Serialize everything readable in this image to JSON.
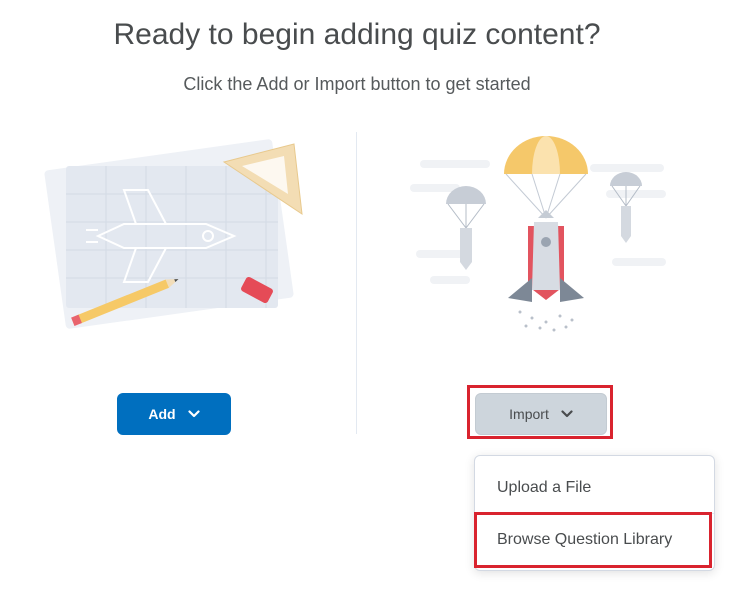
{
  "page": {
    "heading": "Ready to begin adding quiz content?",
    "subheading": "Click the Add or Import button to get started"
  },
  "actions": {
    "add_label": "Add",
    "import_label": "Import"
  },
  "import_menu": {
    "items": [
      {
        "label": "Upload a File"
      },
      {
        "label": "Browse Question Library"
      }
    ]
  },
  "icons": {
    "add_chevron": "chevron-down-icon",
    "import_chevron": "chevron-down-icon"
  },
  "colors": {
    "primary": "#006fbf",
    "secondary_button": "#cdd5dc",
    "highlight": "#d9232e",
    "text": "#494c4e"
  }
}
